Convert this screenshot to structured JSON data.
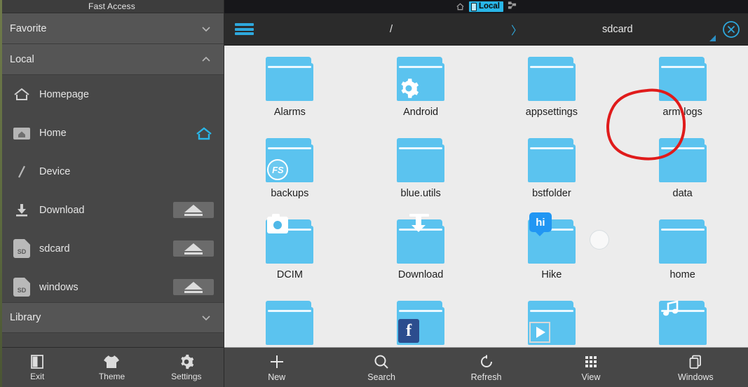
{
  "sidebar": {
    "header": "Fast Access",
    "sections": [
      {
        "label": "Favorite",
        "icon": "chevron-down-icon",
        "expanded": false
      },
      {
        "label": "Local",
        "icon": "chevron-up-icon",
        "expanded": true
      }
    ],
    "items": [
      {
        "label": "Homepage",
        "icon": "home-outline-icon",
        "action": null
      },
      {
        "label": "Home",
        "icon": "folder-home-icon",
        "action": "home-accent-icon"
      },
      {
        "label": "Device",
        "icon": "slash-icon",
        "action": null
      },
      {
        "label": "Download",
        "icon": "download-icon",
        "action": "eject-button"
      },
      {
        "label": "sdcard",
        "icon": "sd-card-icon",
        "action": "eject-button"
      },
      {
        "label": "windows",
        "icon": "sd-card-icon",
        "action": "eject-button"
      }
    ],
    "library": {
      "label": "Library",
      "icon": "chevron-down-icon"
    },
    "bottom_buttons": [
      {
        "label": "Exit",
        "icon": "exit-door-icon"
      },
      {
        "label": "Theme",
        "icon": "tshirt-icon"
      },
      {
        "label": "Settings",
        "icon": "gear-icon"
      }
    ]
  },
  "statusbar": {
    "home_icon": "home-icon",
    "tab_label": "Local",
    "tab_icon": "phone-icon",
    "network_icon": "network-icon"
  },
  "pathbar": {
    "menu_icon": "hamburger-menu-icon",
    "crumbs": [
      {
        "label": "/",
        "type": "crumb"
      },
      {
        "label": "〉",
        "type": "separator"
      },
      {
        "label": "sdcard",
        "type": "crumb"
      }
    ],
    "close_icon": "close-circle-icon",
    "resize_handle": "resize-triangle-icon"
  },
  "files": [
    {
      "name": "Alarms",
      "badge": "none"
    },
    {
      "name": "Android",
      "badge": "gear-icon",
      "annotated": true
    },
    {
      "name": "appsettings",
      "badge": "none"
    },
    {
      "name": "arm-logs",
      "badge": "none"
    },
    {
      "name": "backups",
      "badge": "fs-icon"
    },
    {
      "name": "blue.utils",
      "badge": "none"
    },
    {
      "name": "bstfolder",
      "badge": "none"
    },
    {
      "name": "data",
      "badge": "none"
    },
    {
      "name": "DCIM",
      "badge": "camera-icon"
    },
    {
      "name": "Download",
      "badge": "download-icon"
    },
    {
      "name": "Hike",
      "badge": "hike-icon"
    },
    {
      "name": "home",
      "badge": "none"
    },
    {
      "name": "",
      "badge": "none"
    },
    {
      "name": "",
      "badge": "facebook-icon"
    },
    {
      "name": "",
      "badge": "video-icon"
    },
    {
      "name": "",
      "badge": "music-icon"
    }
  ],
  "main_toolbar": [
    {
      "label": "New",
      "icon": "plus-icon"
    },
    {
      "label": "Search",
      "icon": "search-icon"
    },
    {
      "label": "Refresh",
      "icon": "refresh-icon"
    },
    {
      "label": "View",
      "icon": "grid-view-icon"
    },
    {
      "label": "Windows",
      "icon": "windows-stack-icon"
    }
  ],
  "colors": {
    "accent_blue": "#29b6e8",
    "folder_blue": "#5bc3ef",
    "sidebar_bg": "#474747",
    "section_bg": "#555555",
    "file_area_bg": "#ececec",
    "annotation_red": "#e01b1b"
  }
}
